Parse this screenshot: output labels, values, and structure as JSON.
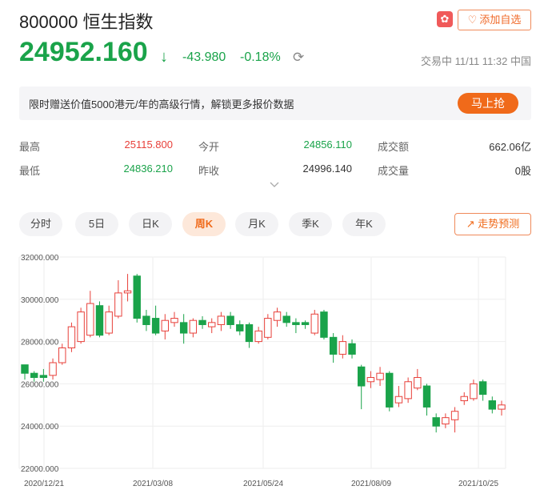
{
  "header": {
    "title": "800000 恒生指数",
    "add_watchlist_label": "添加自选",
    "price": "24952.160",
    "change": "-43.980",
    "change_pct": "-0.18%",
    "trade_status": "交易中 11/11 11:32 中国"
  },
  "promo": {
    "text": "限时赠送价值5000港元/年的高级行情，解锁更多报价数据",
    "button_label": "马上抢"
  },
  "stats": {
    "high_label": "最高",
    "high_value": "25115.800",
    "low_label": "最低",
    "low_value": "24836.210",
    "open_label": "今开",
    "open_value": "24856.110",
    "prev_close_label": "昨收",
    "prev_close_value": "24996.140",
    "turnover_label": "成交额",
    "turnover_value": "662.06亿",
    "volume_label": "成交量",
    "volume_value": "0股"
  },
  "tabs": [
    "分时",
    "5日",
    "日K",
    "周K",
    "月K",
    "季K",
    "年K"
  ],
  "active_tab": "周K",
  "forecast_label": "走势预测",
  "colors": {
    "up": "#e8403a",
    "down": "#1aa34a",
    "accent": "#f06a1a"
  },
  "chart_data": {
    "type": "candlestick",
    "y_ticks": [
      "32000.000",
      "30000.000",
      "28000.000",
      "26000.000",
      "24000.000",
      "22000.000"
    ],
    "x_ticks": [
      "2020/12/21",
      "2021/03/08",
      "2021/05/24",
      "2021/08/09",
      "2021/10/25"
    ],
    "ylim": [
      22000,
      32000
    ],
    "candles": [
      {
        "o": 26900,
        "c": 26500,
        "h": 26900,
        "l": 26200
      },
      {
        "o": 26500,
        "c": 26300,
        "h": 26600,
        "l": 26100
      },
      {
        "o": 26400,
        "c": 26300,
        "h": 26700,
        "l": 26100
      },
      {
        "o": 26400,
        "c": 27000,
        "h": 27200,
        "l": 26200
      },
      {
        "o": 27000,
        "c": 27700,
        "h": 27900,
        "l": 26900
      },
      {
        "o": 27700,
        "c": 28700,
        "h": 28900,
        "l": 27500
      },
      {
        "o": 28000,
        "c": 29400,
        "h": 29600,
        "l": 27900
      },
      {
        "o": 28300,
        "c": 29800,
        "h": 30400,
        "l": 28200
      },
      {
        "o": 29700,
        "c": 28300,
        "h": 29900,
        "l": 28200
      },
      {
        "o": 28400,
        "c": 29400,
        "h": 29700,
        "l": 28300
      },
      {
        "o": 29200,
        "c": 30300,
        "h": 30900,
        "l": 29100
      },
      {
        "o": 30300,
        "c": 30400,
        "h": 31200,
        "l": 29900
      },
      {
        "o": 31100,
        "c": 29100,
        "h": 31200,
        "l": 28900
      },
      {
        "o": 29200,
        "c": 28800,
        "h": 29500,
        "l": 28500
      },
      {
        "o": 29100,
        "c": 28400,
        "h": 29700,
        "l": 28300
      },
      {
        "o": 28500,
        "c": 29000,
        "h": 29300,
        "l": 28100
      },
      {
        "o": 28900,
        "c": 29100,
        "h": 29400,
        "l": 28700
      },
      {
        "o": 28900,
        "c": 28400,
        "h": 29300,
        "l": 27900
      },
      {
        "o": 28400,
        "c": 29000,
        "h": 29100,
        "l": 28200
      },
      {
        "o": 29000,
        "c": 28800,
        "h": 29200,
        "l": 28600
      },
      {
        "o": 28700,
        "c": 28900,
        "h": 29100,
        "l": 28400
      },
      {
        "o": 28800,
        "c": 29200,
        "h": 29400,
        "l": 28500
      },
      {
        "o": 29200,
        "c": 28800,
        "h": 29400,
        "l": 28600
      },
      {
        "o": 28800,
        "c": 28500,
        "h": 29000,
        "l": 28300
      },
      {
        "o": 28800,
        "c": 28000,
        "h": 28900,
        "l": 27700
      },
      {
        "o": 28000,
        "c": 28500,
        "h": 28700,
        "l": 27900
      },
      {
        "o": 28200,
        "c": 29100,
        "h": 29300,
        "l": 28100
      },
      {
        "o": 29000,
        "c": 29400,
        "h": 29600,
        "l": 28700
      },
      {
        "o": 29200,
        "c": 28900,
        "h": 29400,
        "l": 28700
      },
      {
        "o": 28900,
        "c": 28800,
        "h": 29100,
        "l": 28400
      },
      {
        "o": 28900,
        "c": 28800,
        "h": 29000,
        "l": 28600
      },
      {
        "o": 28400,
        "c": 29300,
        "h": 29500,
        "l": 28300
      },
      {
        "o": 29400,
        "c": 28200,
        "h": 29500,
        "l": 28100
      },
      {
        "o": 28200,
        "c": 27400,
        "h": 28400,
        "l": 27000
      },
      {
        "o": 27400,
        "c": 28000,
        "h": 28300,
        "l": 27200
      },
      {
        "o": 27900,
        "c": 27400,
        "h": 28100,
        "l": 27200
      },
      {
        "o": 26800,
        "c": 25900,
        "h": 26900,
        "l": 24800
      },
      {
        "o": 26100,
        "c": 26300,
        "h": 26600,
        "l": 25800
      },
      {
        "o": 26200,
        "c": 26500,
        "h": 26800,
        "l": 25900
      },
      {
        "o": 26500,
        "c": 24900,
        "h": 26600,
        "l": 24700
      },
      {
        "o": 25100,
        "c": 25400,
        "h": 25900,
        "l": 24900
      },
      {
        "o": 25300,
        "c": 26100,
        "h": 26300,
        "l": 25100
      },
      {
        "o": 25800,
        "c": 26300,
        "h": 26700,
        "l": 25700
      },
      {
        "o": 25900,
        "c": 24900,
        "h": 26000,
        "l": 24500
      },
      {
        "o": 24400,
        "c": 24000,
        "h": 24600,
        "l": 23700
      },
      {
        "o": 24100,
        "c": 24400,
        "h": 24600,
        "l": 23900
      },
      {
        "o": 24300,
        "c": 24700,
        "h": 24900,
        "l": 23700
      },
      {
        "o": 25200,
        "c": 25400,
        "h": 25600,
        "l": 25000
      },
      {
        "o": 25300,
        "c": 26000,
        "h": 26200,
        "l": 25200
      },
      {
        "o": 26100,
        "c": 25500,
        "h": 26200,
        "l": 25200
      },
      {
        "o": 25200,
        "c": 24800,
        "h": 25400,
        "l": 24600
      },
      {
        "o": 24800,
        "c": 25000,
        "h": 25200,
        "l": 24500
      }
    ]
  }
}
